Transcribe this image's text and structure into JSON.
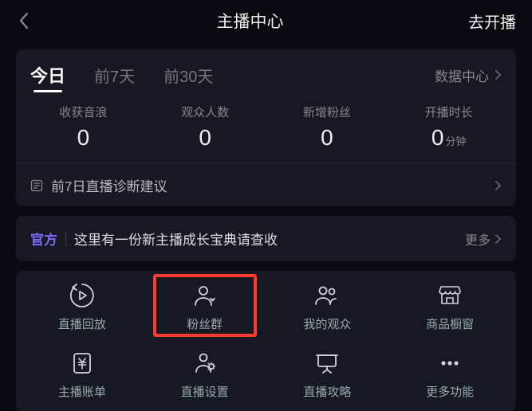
{
  "header": {
    "title": "主播中心",
    "right_action": "去开播"
  },
  "tabs": {
    "items": [
      "今日",
      "前7天",
      "前30天"
    ],
    "active": 0,
    "right_link": "数据中心"
  },
  "stats": [
    {
      "label": "收获音浪",
      "value": "0",
      "unit": ""
    },
    {
      "label": "观众人数",
      "value": "0",
      "unit": ""
    },
    {
      "label": "新增粉丝",
      "value": "0",
      "unit": ""
    },
    {
      "label": "开播时长",
      "value": "0",
      "unit": "分钟"
    }
  ],
  "diagnosis": {
    "text": "前7日直播诊断建议"
  },
  "banner": {
    "tag": "官方",
    "text": "这里有一份新主播成长宝典请查收",
    "more": "更多"
  },
  "functions": [
    {
      "id": "replay",
      "label": "直播回放"
    },
    {
      "id": "fangroup",
      "label": "粉丝群"
    },
    {
      "id": "audience",
      "label": "我的观众"
    },
    {
      "id": "showcase",
      "label": "商品橱窗"
    },
    {
      "id": "bill",
      "label": "主播账单"
    },
    {
      "id": "settings",
      "label": "直播设置"
    },
    {
      "id": "guide",
      "label": "直播攻略"
    },
    {
      "id": "more",
      "label": "更多功能"
    }
  ],
  "highlighted_function": "fangroup"
}
